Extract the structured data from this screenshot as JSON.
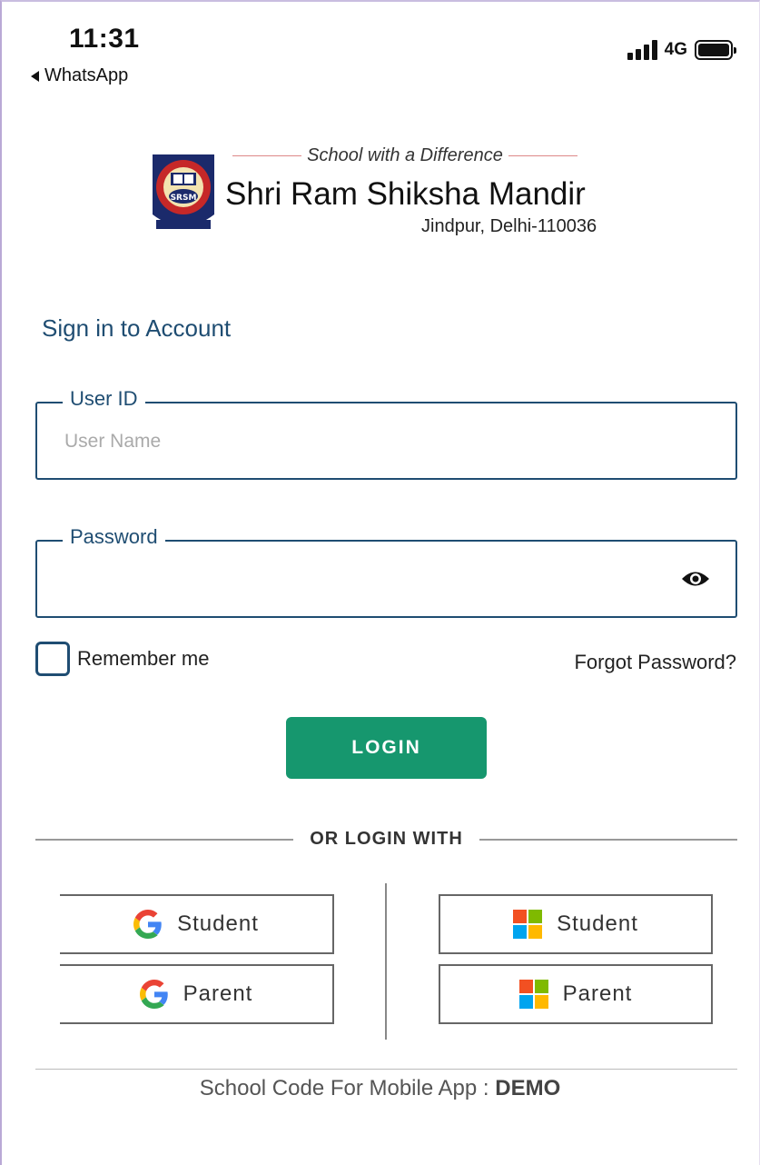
{
  "status_bar": {
    "time": "11:31",
    "back_label": "WhatsApp",
    "network": "4G"
  },
  "header": {
    "tagline": "School with a Difference",
    "school_name": "Shri Ram Shiksha Mandir",
    "address": "Jindpur, Delhi-110036",
    "emblem_text": "SRSM"
  },
  "form": {
    "title": "Sign in to Account",
    "user_id_label": "User ID",
    "user_id_placeholder": "User Name",
    "user_id_value": "",
    "password_label": "Password",
    "password_value": "",
    "remember_label": "Remember me",
    "remember_checked": false,
    "forgot_label": "Forgot Password?",
    "login_label": "LOGIN"
  },
  "sso": {
    "divider_label": "OR LOGIN WITH",
    "google_student": "Student",
    "google_parent": "Parent",
    "microsoft_student": "Student",
    "microsoft_parent": "Parent"
  },
  "footer": {
    "school_code_label": "School Code For Mobile App :",
    "school_code_value": "DEMO"
  },
  "colors": {
    "primary": "#1f4d72",
    "login_button": "#16976e",
    "google_blue": "#4285F4",
    "google_red": "#EA4335",
    "google_yellow": "#FBBC05",
    "google_green": "#34A853",
    "ms_red": "#F25022",
    "ms_green": "#7FBA00",
    "ms_blue": "#00A4EF",
    "ms_yellow": "#FFB900"
  }
}
